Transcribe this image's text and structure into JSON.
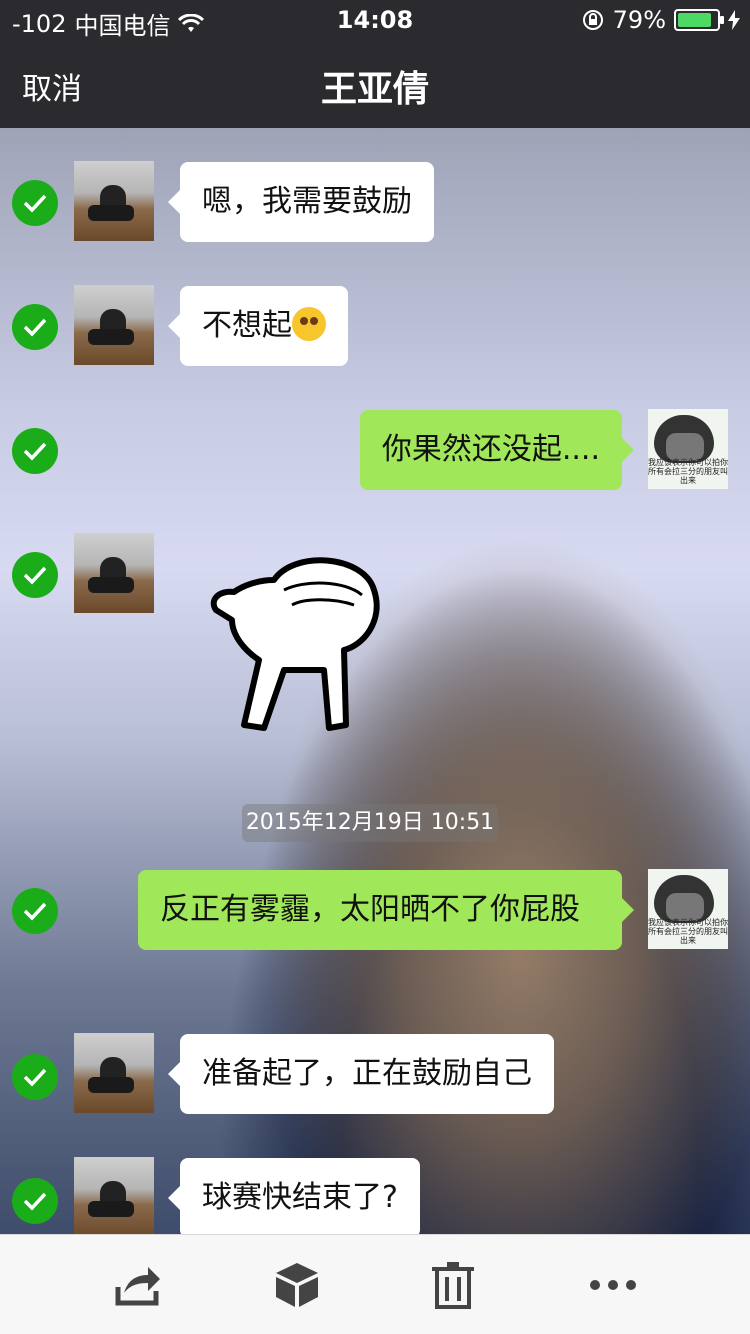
{
  "status_bar": {
    "signal": "-102",
    "carrier": "中国电信",
    "time": "14:08",
    "battery": "79%",
    "battery_level": 0.79
  },
  "nav": {
    "cancel_label": "取消",
    "title": "王亚倩"
  },
  "messages": [
    {
      "side": "left",
      "text": "嗯，我需要鼓励",
      "selected": true
    },
    {
      "side": "left",
      "text": "不想起",
      "emoji": "emoji-icon",
      "selected": true
    },
    {
      "side": "right",
      "text": "你果然还没起....",
      "selected": true
    },
    {
      "side": "left",
      "sticker": "cartoon-sticker",
      "selected": true
    },
    {
      "side": "right",
      "text": "反正有雾霾，太阳晒不了你屁股",
      "selected": true
    },
    {
      "side": "left",
      "text": "准备起了，正在鼓励自己",
      "selected": true
    },
    {
      "side": "left",
      "text": "球赛快结束了?",
      "selected": true
    }
  ],
  "timestamp": "2015年12月19日 10:51",
  "my_avatar_caption": "我应该表示你可以拍你所有会拉三分的朋友叫出来",
  "toolbar": {
    "icons": [
      "share-icon",
      "box-icon",
      "trash-icon",
      "more-icon"
    ]
  },
  "colors": {
    "nav_bg": "#2b2b2f",
    "check_green": "#1aad19",
    "bubble_green": "#a0e75a",
    "bubble_white": "#ffffff"
  }
}
